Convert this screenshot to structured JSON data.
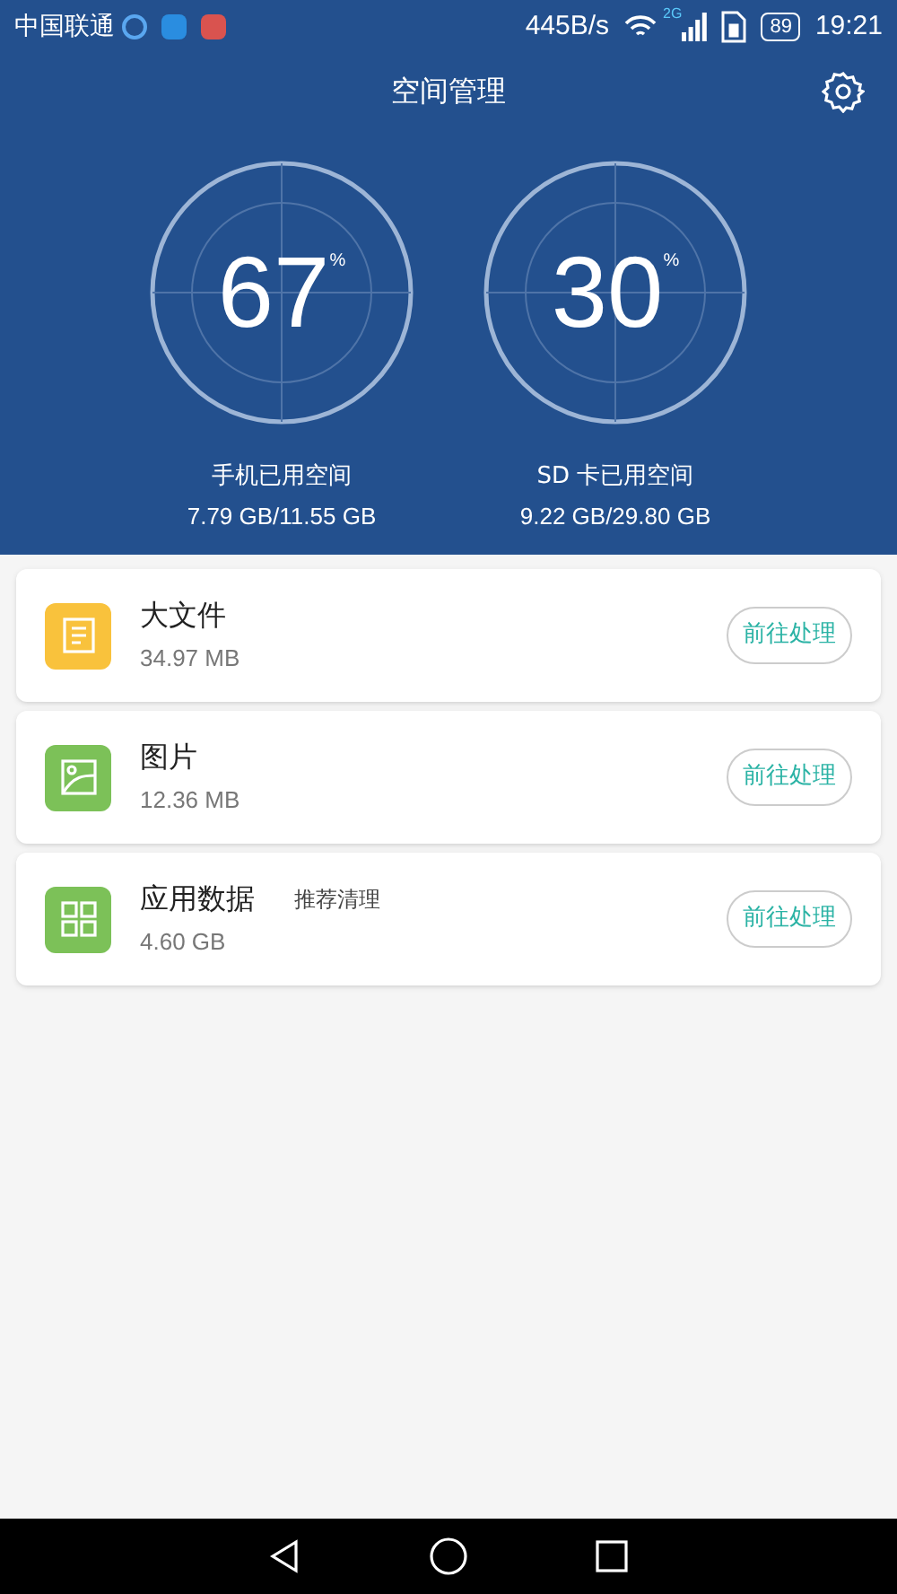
{
  "status_bar": {
    "carrier": "中国联通",
    "speed": "445B/s",
    "network": "2G",
    "battery": "89",
    "time": "19:21"
  },
  "header": {
    "title": "空间管理"
  },
  "gauges": [
    {
      "value": "67",
      "unit": "%",
      "label": "手机已用空间",
      "usage": "7.79 GB/11.55 GB"
    },
    {
      "value": "30",
      "unit": "%",
      "label": "SD 卡已用空间",
      "usage": "9.22 GB/29.80 GB"
    }
  ],
  "items": [
    {
      "kind": "document",
      "color": "#f9c23c",
      "name": "大文件",
      "size": "34.97 MB",
      "button": "前往处理"
    },
    {
      "kind": "image",
      "color": "#7cc158",
      "name": "图片",
      "size": "12.36 MB",
      "button": "前往处理"
    },
    {
      "kind": "apps",
      "color": "#7cc158",
      "name": "应用数据",
      "tag": "推荐清理",
      "size": "4.60 GB",
      "button": "前往处理"
    }
  ]
}
